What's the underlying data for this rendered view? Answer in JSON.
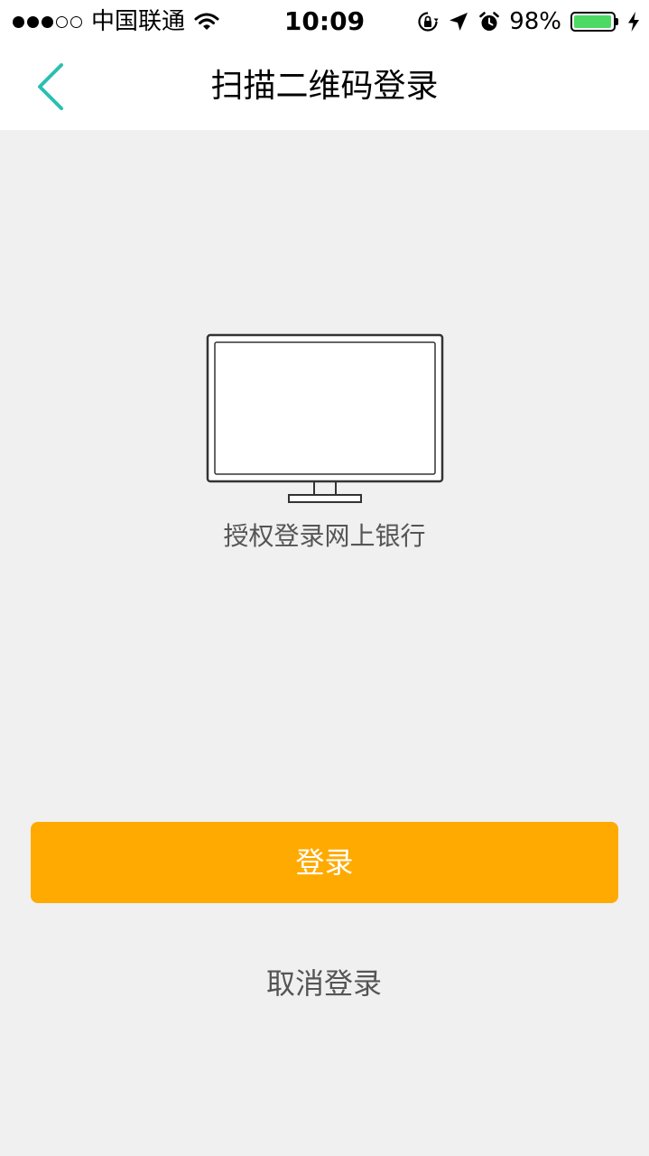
{
  "status_bar": {
    "carrier": "中国联通",
    "time": "10:09",
    "battery_percent": "98%",
    "battery_level": 0.98,
    "signal_bars_filled": 3,
    "signal_bars_total": 5,
    "icons": [
      "wifi-icon",
      "orientation-lock-icon",
      "location-arrow-icon",
      "alarm-icon",
      "battery-icon",
      "charging-bolt-icon"
    ]
  },
  "nav": {
    "back_icon": "chevron-left-icon",
    "title": "扫描二维码登录"
  },
  "content": {
    "illustration_icon": "monitor-icon",
    "auth_text": "授权登录网上银行"
  },
  "actions": {
    "login_label": "登录",
    "cancel_label": "取消登录"
  },
  "colors": {
    "accent_teal": "#2bbfb3",
    "login_button": "#ffaa00",
    "background": "#f0f0f0",
    "battery_green": "#4cd964"
  }
}
